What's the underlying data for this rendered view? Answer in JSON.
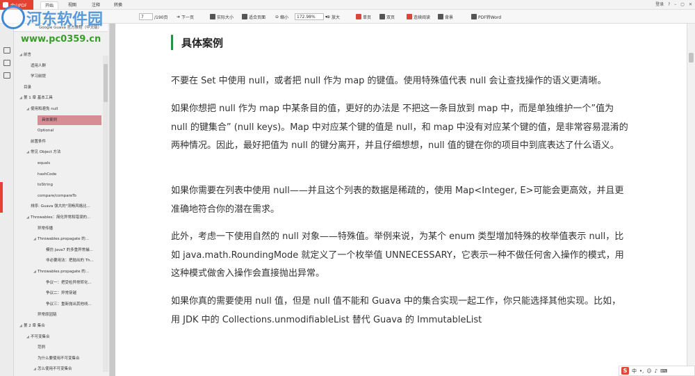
{
  "app": {
    "name": "金山PDF"
  },
  "menu": {
    "tabs": [
      "开始",
      "视图",
      "注释",
      "转换"
    ],
    "active": "开始"
  },
  "window_controls": [
    "登录",
    "?"
  ],
  "toolbar": {
    "page_current": "7",
    "page_total": "/190页",
    "next_page": "下一页",
    "actual_size": "实际大小",
    "fit_page": "适合页面",
    "zoom_out": "缩小",
    "zoom_value": "172.98%",
    "zoom_in": "放大",
    "single_page": "单页",
    "double_page": "双页",
    "continuous": "连续阅读",
    "background": "背景",
    "pdf_to_word": "PDF转Word"
  },
  "document_tab": "Google Guava 官方教程（中文版）",
  "watermark": {
    "title": "河东软件园",
    "url": "www.pc0359.cn"
  },
  "toc": {
    "items": [
      {
        "label": "前言",
        "level": 1,
        "expand": "◢"
      },
      {
        "label": "适用人群",
        "level": 2
      },
      {
        "label": "学习前提",
        "level": 2
      },
      {
        "label": "目录",
        "level": 1
      },
      {
        "label": "第 1 章 基本工具",
        "level": 1,
        "expand": "◢"
      },
      {
        "label": "使用和避免 null",
        "level": 2,
        "expand": "◢"
      },
      {
        "label": "具体案例",
        "level": 3,
        "selected": true
      },
      {
        "label": "Optional",
        "level": 3
      },
      {
        "label": "前置条件",
        "level": 2
      },
      {
        "label": "常见 Object 方法",
        "level": 2,
        "expand": "◢"
      },
      {
        "label": "equals",
        "level": 3
      },
      {
        "label": "hashCode",
        "level": 3
      },
      {
        "label": "toString",
        "level": 3
      },
      {
        "label": "compare/compareTo",
        "level": 3
      },
      {
        "label": "排序: Guava 强大的\"流畅风格比...",
        "level": 2
      },
      {
        "label": "Throwables：简化异常和错误的...",
        "level": 2,
        "expand": "◢"
      },
      {
        "label": "异常传播",
        "level": 3
      },
      {
        "label": "Throwables.propagate 的...",
        "level": 3,
        "expand": "◢"
      },
      {
        "label": "模仿 Java7 的多重异常捕...",
        "level": 4
      },
      {
        "label": "非必要用法：把抛出的 Th...",
        "level": 4
      },
      {
        "label": "Throwables.propagate 的...",
        "level": 3,
        "expand": "◢"
      },
      {
        "label": "争议一：把受检异常转化...",
        "level": 4
      },
      {
        "label": "争议二：异常穿越",
        "level": 4
      },
      {
        "label": "争议三：重新抛出其他线...",
        "level": 4
      },
      {
        "label": "异常原因链",
        "level": 3
      },
      {
        "label": "第 2 章 集合",
        "level": 1,
        "expand": "◢"
      },
      {
        "label": "不可变集合",
        "level": 2,
        "expand": "◢"
      },
      {
        "label": "范例",
        "level": 3
      },
      {
        "label": "为什么要使用不可变集合",
        "level": 3
      },
      {
        "label": "怎么使用不可变集合",
        "level": 3,
        "expand": "◢"
      }
    ]
  },
  "content": {
    "heading": "具体案例",
    "paragraphs": [
      "不要在 Set 中使用 null，或者把 null 作为 map 的键值。使用特殊值代表 null 会让查找操作的语义更清晰。",
      "如果你想把 null 作为 map 中某条目的值，更好的办法是 不把这一条目放到 map 中，而是单独维护一个”值为 null 的键集合” (null keys)。Map 中对应某个键的值是 null，和 map 中没有对应某个键的值，是非常容易混淆的两种情况。因此，最好把值为 null 的键分离开，并且仔细想想，null 值的键在你的项目中到底表达了什么语义。",
      "如果你需要在列表中使用 null——并且这个列表的数据是稀疏的，使用 Map<Integer, E>可能会更高效，并且更准确地符合你的潜在需求。",
      "此外，考虑一下使用自然的 null 对象——特殊值。举例来说，为某个 enum 类型增加特殊的枚举值表示 null，比如 java.math.RoundingMode 就定义了一个枚举值 UNNECESSARY，它表示一种不做任何舍入操作的模式，用这种模式做舍入操作会直接抛出异常。",
      "如果你真的需要使用 null 值，但是 null 值不能和 Guava 中的集合实现一起工作，你只能选择其他实现。比如，用 JDK 中的 Collections.unmodifiableList 替代 Guava 的 ImmutableList"
    ]
  },
  "ime": {
    "label": "中"
  },
  "colors": {
    "accent": "#e34132",
    "heading_bar": "#2d8f43",
    "toc_selected": "#d68d93"
  }
}
